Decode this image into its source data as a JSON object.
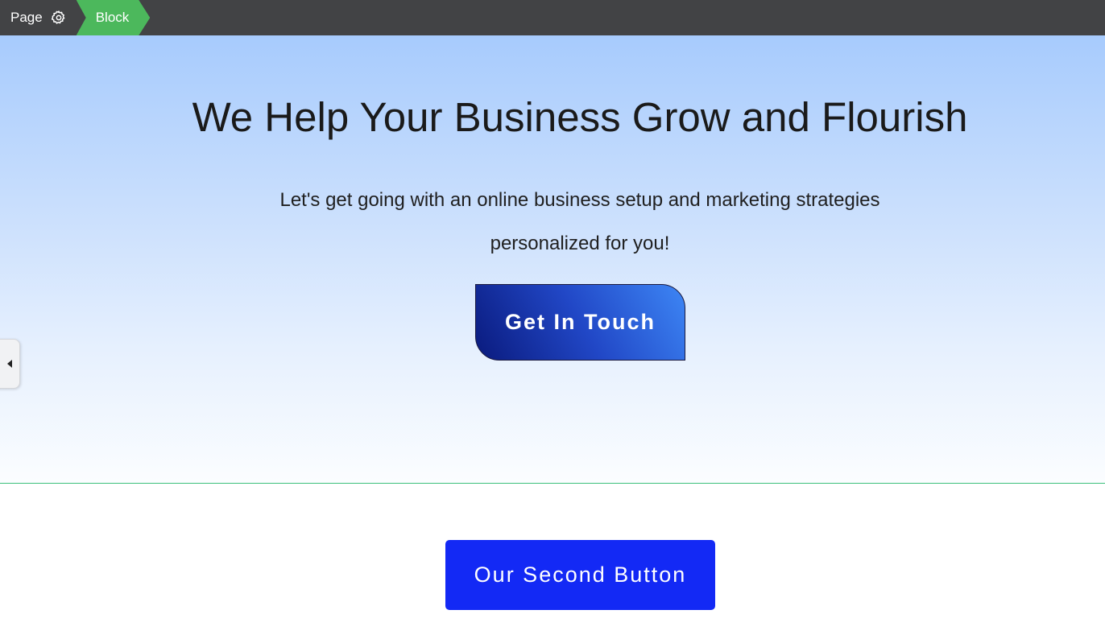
{
  "breadcrumb": {
    "page_label": "Page",
    "page_icon": "gear-icon",
    "block_label": "Block"
  },
  "hero": {
    "title": "We Help Your Business Grow and Flourish",
    "subtitle_line1": "Let's get going with an online business setup and marketing strategies",
    "subtitle_line2": "personalized for you!",
    "cta_label": "Get In Touch"
  },
  "side_panel": {
    "toggle_icon": "caret-left-icon"
  },
  "second_section": {
    "button_label": "Our Second Button"
  },
  "colors": {
    "topbar": "#424345",
    "breadcrumb_active": "#4cb85c",
    "hero_top": "#a7cbfd",
    "hero_bottom": "#fbfdff",
    "section_divider": "#3bbf7a",
    "cta_dark": "#0a1a7d",
    "cta_light": "#3d86f5",
    "second_button": "#1329f5"
  }
}
